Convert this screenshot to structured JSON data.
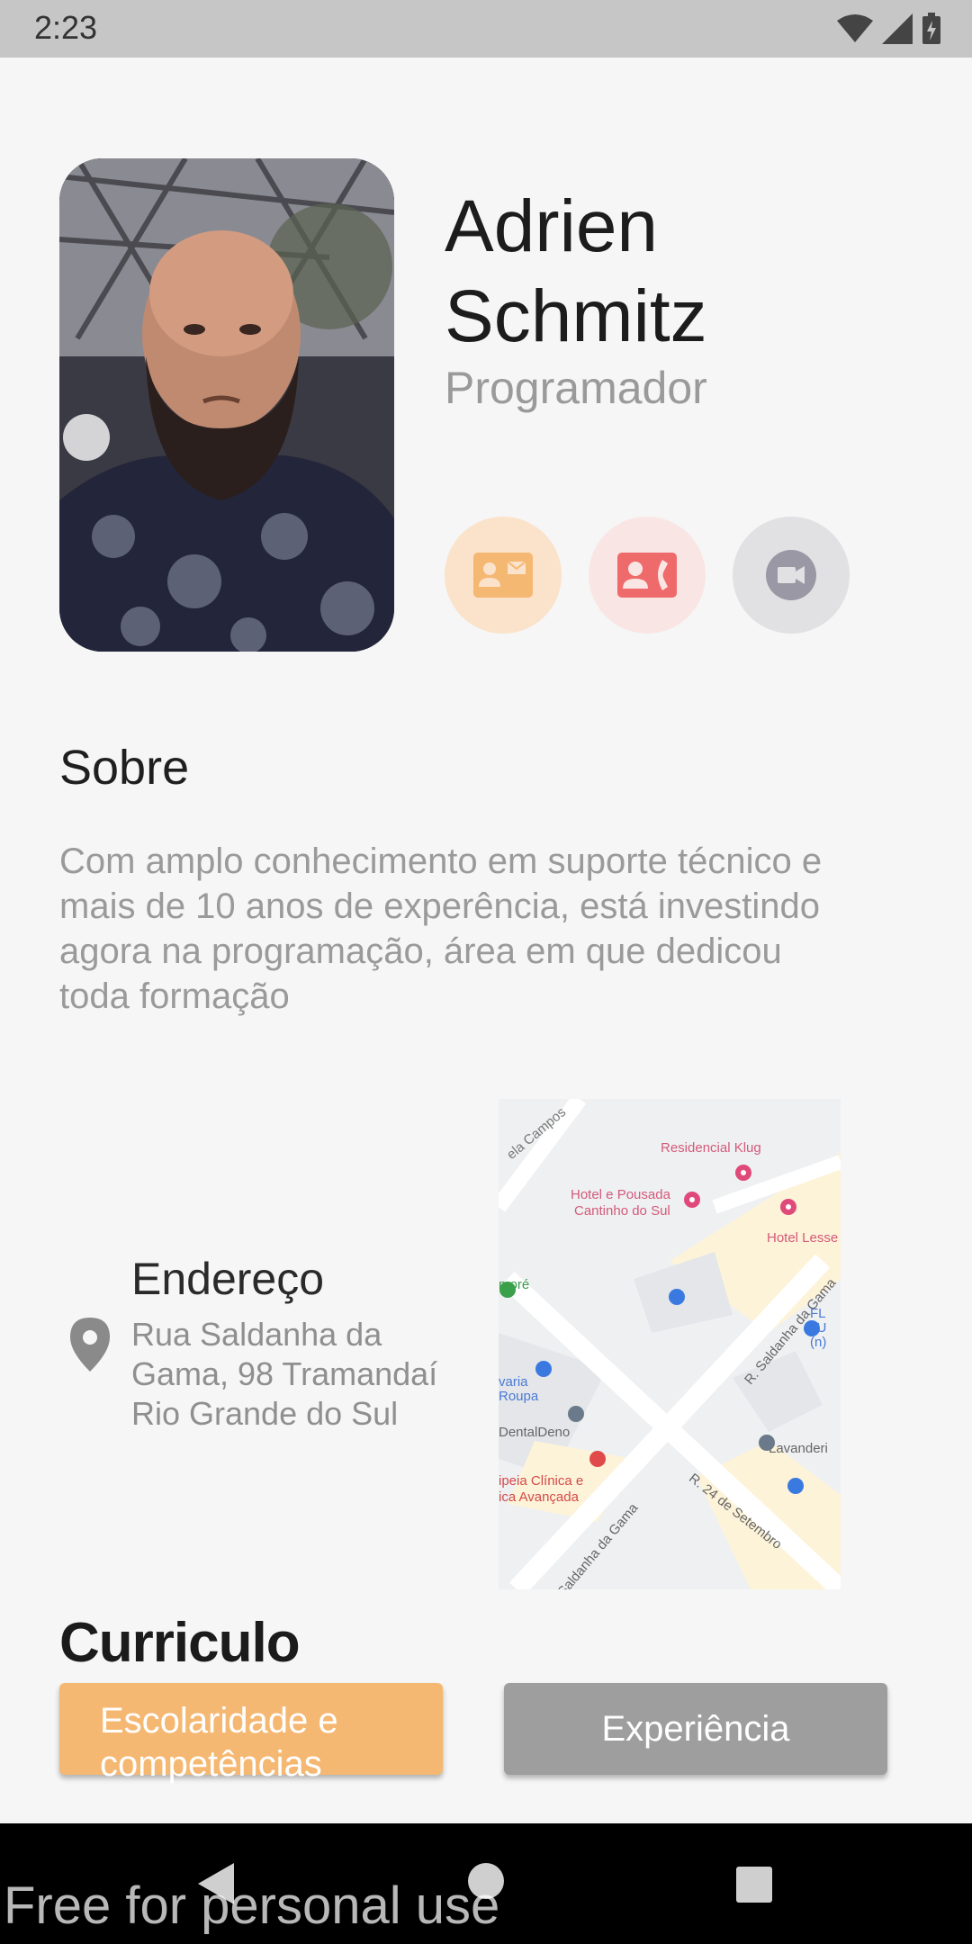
{
  "status_bar": {
    "time": "2:23"
  },
  "profile": {
    "name_line1": "Adrien",
    "name_line2": "Schmitz",
    "role": "Programador"
  },
  "actions": [
    {
      "icon": "contact-card-icon",
      "color": "#f5b872"
    },
    {
      "icon": "contact-phone-icon",
      "color": "#ef6a6a"
    },
    {
      "icon": "video-call-icon",
      "color": "#9a98a4"
    }
  ],
  "about": {
    "title": "Sobre",
    "line1": "Com amplo conhecimento em suporte técnico e",
    "line2": "mais de 10 anos de experência, está investindo",
    "line3": "agora na programação, área em que dedicou",
    "line4": "toda formação"
  },
  "address": {
    "title": "Endereço",
    "line1": "Rua Saldanha da",
    "line2": "Gama, 98 Tramandaí",
    "line3": "Rio Grande do Sul"
  },
  "map": {
    "labels": {
      "street_top": "ela Campos",
      "residencial": "Residencial Klug",
      "hotel_1": "Hotel e Pousada",
      "hotel_2": "Cantinho do Sul",
      "hotel_lesse": "Hotel Lesse",
      "more": "moré",
      "street_saldanha_1": "R. Saldanha da Gama",
      "street_saldanha_2": "R. Saldanha da Gama",
      "street_setembro": "R. 24 de Setembro",
      "lavanderia_roupa_1": "varia",
      "lavanderia_roupa_2": "Roupa",
      "dental": "DentalDeno",
      "clinica_1": "ipeia Clínica e",
      "clinica_2": "ica Avançada",
      "lavanderi": "Lavanderi",
      "fl_1": "FL",
      "fl_2": "JU",
      "fl_3": "(n)"
    }
  },
  "curriculum": {
    "title": "Curriculo",
    "tab_school": "Escolaridade e competências",
    "tab_experience": "Experiência"
  },
  "watermark": "Free for personal use"
}
